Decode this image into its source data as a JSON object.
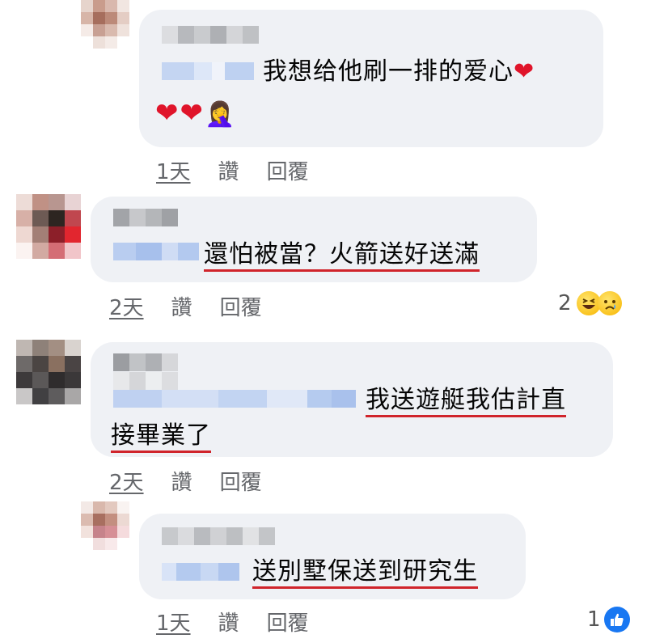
{
  "comments": [
    {
      "text_line1": "我想给他刷一排的爱心",
      "text_line2": "",
      "emoji_trail": "❤",
      "emoji_line2": "❤❤",
      "person_emoji": "🤦‍♀️",
      "time": "1天",
      "like_label": "讚",
      "reply_label": "回覆",
      "reaction_count": ""
    },
    {
      "text_line1": "還怕被當？火箭送好送滿",
      "time": "2天",
      "like_label": "讚",
      "reply_label": "回覆",
      "reaction_count": "2"
    },
    {
      "text_line1": "我送遊艇我估計直",
      "text_line2": "接畢業了",
      "time": "2天",
      "like_label": "讚",
      "reply_label": "回覆",
      "reaction_count": ""
    },
    {
      "text_line1": "送別墅保送到研究生",
      "time": "1天",
      "like_label": "讚",
      "reply_label": "回覆",
      "reaction_count": "1"
    }
  ],
  "icons": {
    "laugh": "laugh-reaction-icon",
    "sad": "sad-reaction-icon",
    "like": "like-reaction-icon",
    "heart": "heart-icon"
  },
  "colors": {
    "bubble": "#eff1f5",
    "underline": "#d0242b",
    "meta": "#65676b",
    "like_blue": "#1877f2"
  }
}
